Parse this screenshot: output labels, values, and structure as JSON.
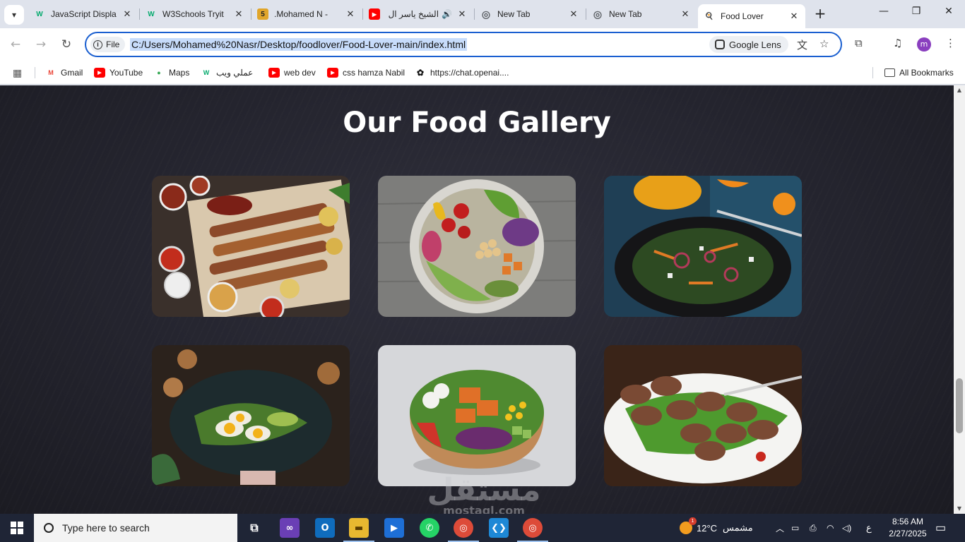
{
  "browser": {
    "tabs": [
      {
        "title": "JavaScript Displa",
        "favicon": "W",
        "favicon_color": "#04aa6d"
      },
      {
        "title": "W3Schools Tryit",
        "favicon": "W",
        "favicon_color": "#04aa6d"
      },
      {
        "title": ".Mohamed N - ",
        "favicon": "5",
        "favicon_color": "#e0a52a"
      },
      {
        "title": "الشيخ ياسر ال",
        "favicon": "▶",
        "favicon_color": "#ff0000"
      },
      {
        "title": "New Tab",
        "favicon": "◎",
        "favicon_color": "#5f6368"
      },
      {
        "title": "New Tab",
        "favicon": "◎",
        "favicon_color": "#5f6368"
      },
      {
        "title": "Food Lover",
        "favicon": "🍳",
        "favicon_color": "#c65a1e"
      }
    ],
    "active_tab_index": 6,
    "new_tab_label": "+",
    "file_chip": "File",
    "url": "C:/Users/Mohamed%20Nasr/Desktop/foodlover/Food-Lover-main/index.html",
    "google_lens_label": "Google Lens",
    "profile_initial": "m",
    "accent_color": "#1a5fd0"
  },
  "bookmarks": [
    {
      "label": "Gmail",
      "icon": "gmail-icon",
      "glyph": "M",
      "color": "#ea4335"
    },
    {
      "label": "YouTube",
      "icon": "youtube-icon",
      "glyph": "▶",
      "color": "#ff0000"
    },
    {
      "label": "Maps",
      "icon": "maps-icon",
      "glyph": "●",
      "color": "#34a853"
    },
    {
      "label": "عملي ويب",
      "icon": "w3schools-icon",
      "glyph": "W",
      "color": "#04aa6d"
    },
    {
      "label": "web dev",
      "icon": "youtube-icon",
      "glyph": "▶",
      "color": "#ff0000"
    },
    {
      "label": "css hamza Nabil",
      "icon": "youtube-icon",
      "glyph": "▶",
      "color": "#ff0000"
    },
    {
      "label": "https://chat.openai....",
      "icon": "openai-icon",
      "glyph": "✿",
      "color": "#111111"
    }
  ],
  "all_bookmarks_label": "All Bookmarks",
  "page": {
    "gallery_title": "Our Food Gallery",
    "images": [
      {
        "name": "grilled-kebab-platter-image",
        "alt": "grilled kebab platter"
      },
      {
        "name": "veggie-bowl-image",
        "alt": "vegetable bowl"
      },
      {
        "name": "dark-salad-plate-image",
        "alt": "salad plate"
      },
      {
        "name": "egg-avocado-plate-image",
        "alt": "egg avocado plate"
      },
      {
        "name": "tofu-salad-bowl-image",
        "alt": "tofu salad bowl"
      },
      {
        "name": "meatballs-plate-image",
        "alt": "meatballs plate"
      }
    ],
    "background_color": "#25252f"
  },
  "watermark": {
    "text": "مستقل",
    "sub": "mostaql.com"
  },
  "taskbar": {
    "search_placeholder": "Type here to search",
    "weather_temp": "12°C",
    "weather_label": "مشمس",
    "weather_badge": "1",
    "language": "ع",
    "time": "8:56 AM",
    "date": "2/27/2025"
  }
}
